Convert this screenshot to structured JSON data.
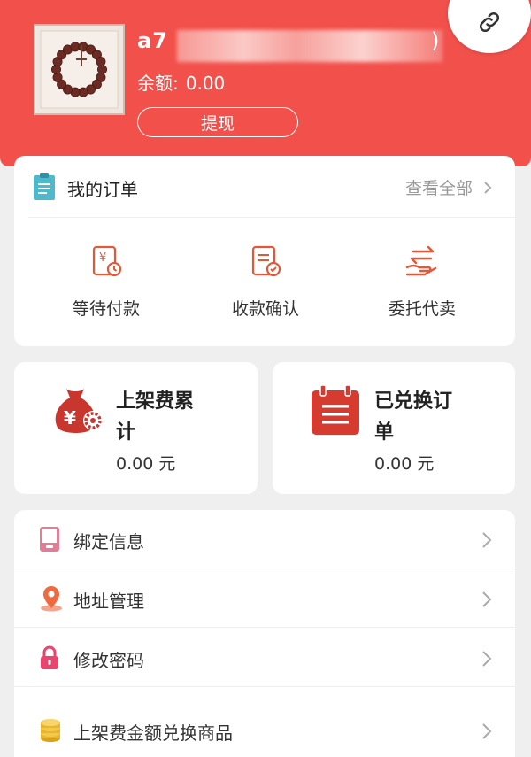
{
  "profile": {
    "username_visible": "a7",
    "username_suffix": ")",
    "balance_label": "余额:",
    "balance_value": "0.00",
    "withdraw_label": "提现"
  },
  "orders": {
    "title": "我的订单",
    "view_all": "查看全部",
    "items": [
      {
        "label": "等待付款",
        "icon": "payment-pending-icon"
      },
      {
        "label": "收款确认",
        "icon": "receipt-confirm-icon"
      },
      {
        "label": "委托代卖",
        "icon": "consign-sell-icon"
      }
    ]
  },
  "stats": [
    {
      "title_line1": "上架费累",
      "title_line2": "计",
      "value": "0.00 元",
      "icon": "money-bag-icon"
    },
    {
      "title_line1": "已兑换订",
      "title_line2": "单",
      "value": "0.00 元",
      "icon": "calendar-list-icon"
    }
  ],
  "menu": [
    {
      "label": "绑定信息",
      "icon": "bind-info-icon"
    },
    {
      "label": "地址管理",
      "icon": "location-pin-icon"
    },
    {
      "label": "修改密码",
      "icon": "lock-icon"
    },
    {
      "label": "上架费金额兑换商品",
      "icon": "coins-icon"
    }
  ],
  "colors": {
    "brand": "#f2504b",
    "accent_icon": "#e05a3a",
    "background": "#efefef"
  }
}
